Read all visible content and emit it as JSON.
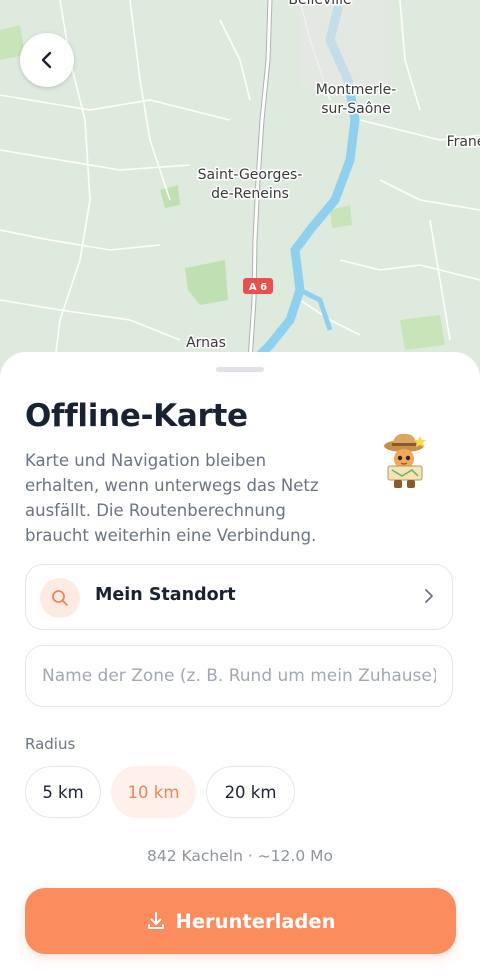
{
  "map": {
    "places": {
      "belleville": "Belleville",
      "montmerle_line1": "Montmerle-",
      "montmerle_line2": "sur-Saône",
      "francheleins": "Frane",
      "saint_georges_line1": "Saint-Georges-",
      "saint_georges_line2": "de-Reneins",
      "arnas": "Arnas"
    },
    "road_shield": "A 6",
    "colors": {
      "land": "#dfeadf",
      "water": "#8fd0ee",
      "park": "#bfe0b0",
      "road": "#ffffff",
      "highway": "#e85050"
    }
  },
  "back_button": {
    "icon": "chevron-left-icon"
  },
  "sheet": {
    "title": "Offline-Karte",
    "description": "Karte und Navigation bleiben erhalten, wenn unterwegs das Netz ausfällt. Die Routenberechnung braucht weiterhin eine Verbindung.",
    "mascot_icon": "explorer-mascot-icon",
    "location": {
      "label": "Mein Standort",
      "icon": "search-icon",
      "chevron": "chevron-right-icon"
    },
    "zone_input": {
      "value": "",
      "placeholder": "Name der Zone (z. B. Rund um mein Zuhause)"
    },
    "radius": {
      "label": "Radius",
      "options": [
        {
          "label": "5 km",
          "selected": false
        },
        {
          "label": "10 km",
          "selected": true
        },
        {
          "label": "20 km",
          "selected": false
        }
      ]
    },
    "estimate": "842 Kacheln · ~12.0 Mo",
    "download_label": "Herunterladen",
    "download_icon": "download-icon",
    "accent_color": "#fb8c5e"
  }
}
